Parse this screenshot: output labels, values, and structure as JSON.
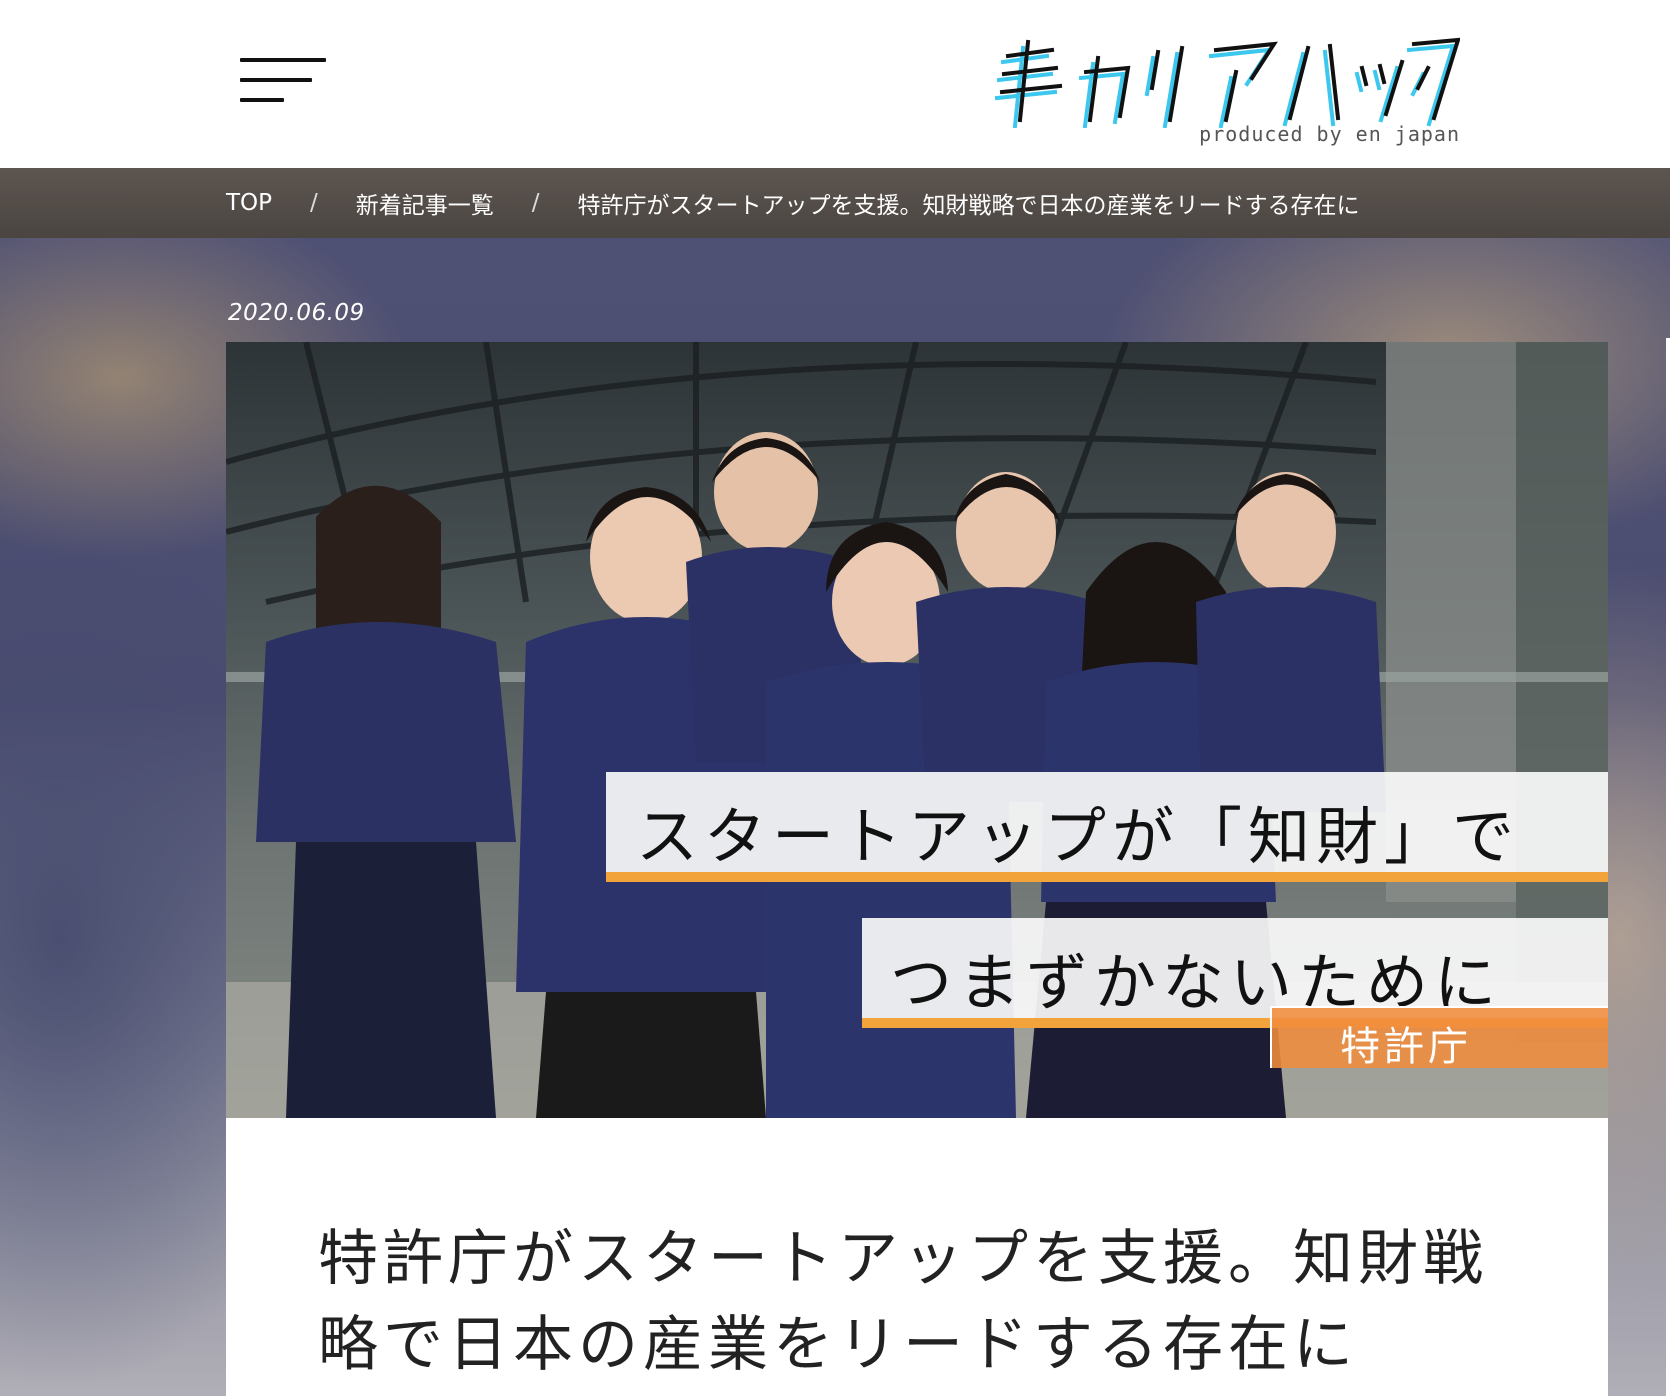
{
  "header": {
    "logo_text": "キャリアハック",
    "logo_sub": "produced by en japan"
  },
  "breadcrumb": {
    "items": [
      {
        "label": "TOP"
      },
      {
        "label": "新着記事一覧"
      },
      {
        "label": "特許庁がスタートアップを支援。知財戦略で日本の産業をリードする存在に"
      }
    ],
    "separator": "/"
  },
  "article": {
    "date": "2020.06.09",
    "title": "特許庁がスタートアップを支援。知財戦略で日本の産業をリードする存在に",
    "image_overlay": {
      "line1": "スタートアップが「知財」で",
      "line2": "つまずかないために",
      "tag": "特許庁"
    }
  },
  "colors": {
    "accent_orange": "#f2a33a",
    "breadcrumb_bg": "#4b4541"
  }
}
